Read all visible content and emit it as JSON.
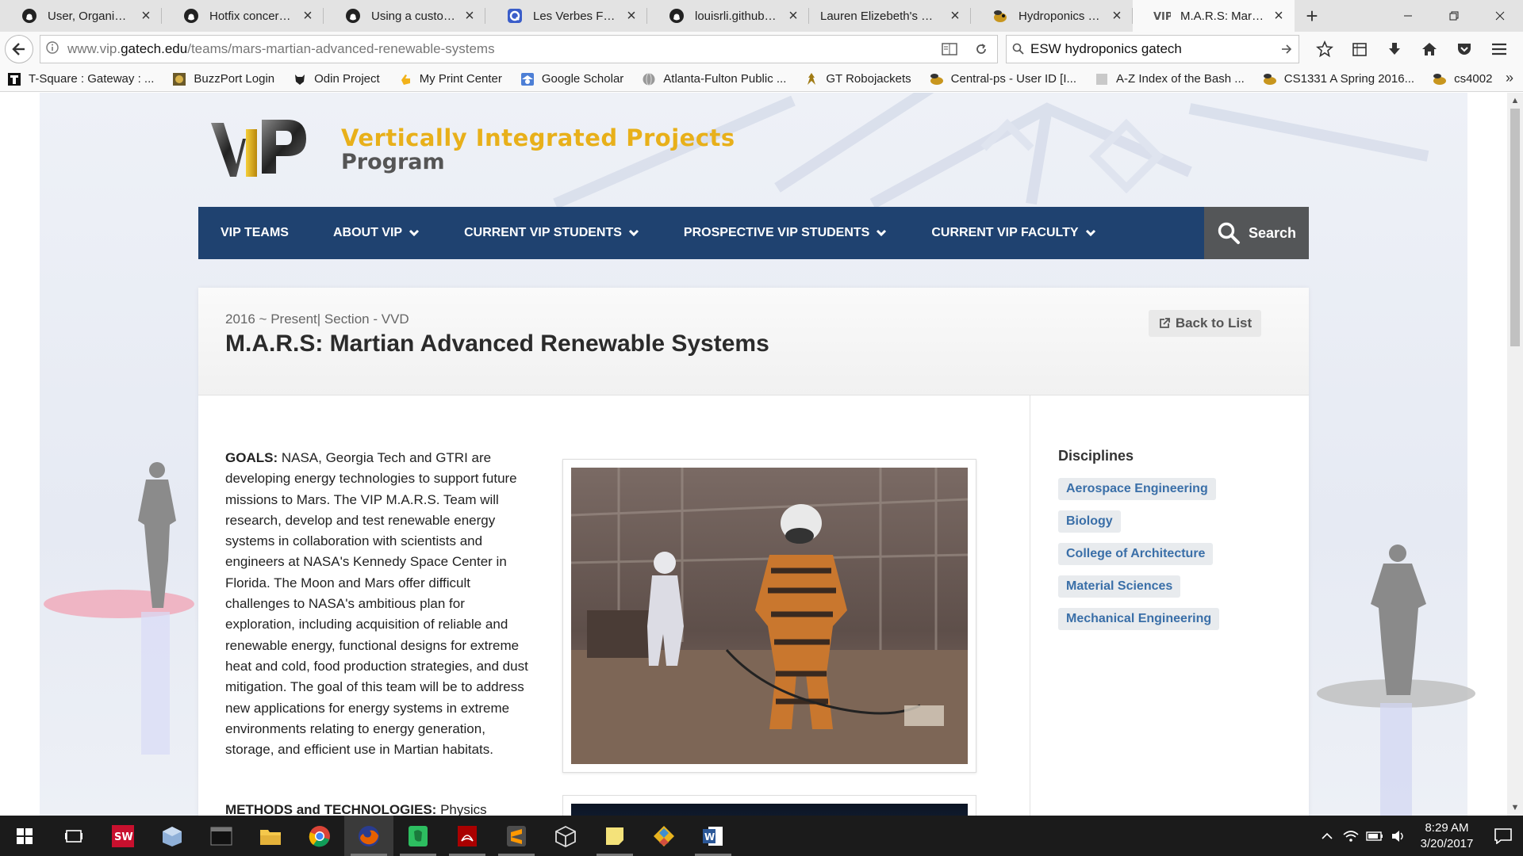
{
  "browser": {
    "tabs": [
      {
        "title": "User, Organizatio...",
        "icon": "github-icon"
      },
      {
        "title": "Hotfix concernin...",
        "icon": "github-icon"
      },
      {
        "title": "Using a custom d...",
        "icon": "github-icon"
      },
      {
        "title": "Les Verbes Flashc...",
        "icon": "quizlet-icon"
      },
      {
        "title": "louisrli.github.co...",
        "icon": "github-icon"
      },
      {
        "title": "Lauren Elizebeth's Per...",
        "icon": "none"
      },
      {
        "title": "Hydroponics proj...",
        "icon": "buzz-icon"
      },
      {
        "title": "M.A.R.S: Martian ...",
        "icon": "vip-icon",
        "active": true
      }
    ],
    "url_prefix": "www.vip.",
    "url_domain": "gatech.edu",
    "url_path": "/teams/mars-martian-advanced-renewable-systems",
    "search_query": "ESW hydroponics gatech",
    "bookmarks": [
      {
        "label": "T-Square : Gateway : ...",
        "icon": "tsquare-icon"
      },
      {
        "label": "BuzzPort Login",
        "icon": "buzzport-icon"
      },
      {
        "label": "Odin Project",
        "icon": "odin-icon"
      },
      {
        "label": "My Print Center",
        "icon": "hand-icon"
      },
      {
        "label": "Google Scholar",
        "icon": "scholar-icon"
      },
      {
        "label": "Atlanta-Fulton Public ...",
        "icon": "globe-icon"
      },
      {
        "label": "GT Robojackets",
        "icon": "robo-icon"
      },
      {
        "label": "Central-ps - User ID [I...",
        "icon": "buzz-icon"
      },
      {
        "label": "A-Z Index of the Bash ...",
        "icon": "square-icon"
      },
      {
        "label": "CS1331 A Spring 2016...",
        "icon": "buzz-icon"
      },
      {
        "label": "cs4002",
        "icon": "buzz-icon"
      }
    ]
  },
  "site": {
    "title": "Vertically Integrated Projects",
    "subtitle": "Program",
    "logo_text": "VIP",
    "nav": [
      {
        "label": "VIP TEAMS",
        "dropdown": false
      },
      {
        "label": "ABOUT VIP",
        "dropdown": true
      },
      {
        "label": "CURRENT VIP STUDENTS",
        "dropdown": true
      },
      {
        "label": "PROSPECTIVE VIP STUDENTS",
        "dropdown": true
      },
      {
        "label": "CURRENT VIP FACULTY",
        "dropdown": true
      }
    ],
    "search_label": "Search"
  },
  "team": {
    "meta": "2016 ~ Present| Section - VVD",
    "title": "M.A.R.S: Martian Advanced Renewable Systems",
    "back_label": "Back to List",
    "goals_label": "GOALS:",
    "goals_text": "NASA, Georgia Tech and GTRI are developing energy technologies to support future missions to Mars. The VIP M.A.R.S. Team will research, develop and test renewable energy systems in collaboration with scientists and engineers at NASA's Kennedy Space Center in Florida. The Moon and Mars offer difficult challenges to NASA's ambitious plan for exploration, including acquisition of reliable and renewable energy, functional designs for extreme heat and cold, food production strategies, and dust mitigation. The goal of this team will be to address new applications for energy systems in extreme environments relating to energy generation, storage, and efficient use in Martian habitats.",
    "methods_label": "METHODS and TECHNOLOGIES:",
    "methods_text": "Physics",
    "disciplines_title": "Disciplines",
    "disciplines": [
      "Aerospace Engineering",
      "Biology",
      "College of Architecture",
      "Material Sciences",
      "Mechanical Engineering"
    ]
  },
  "taskbar": {
    "apps": [
      "solidworks-icon",
      "virtualbox-icon",
      "terminal-icon",
      "file-explorer-icon",
      "chrome-icon",
      "firefox-icon",
      "evernote-icon",
      "acrobat-icon",
      "sublime-icon",
      "cube-icon",
      "sticky-notes-icon",
      "git-icon",
      "word-icon"
    ],
    "time": "8:29 AM",
    "date": "3/20/2017"
  },
  "colors": {
    "nav_blue": "#1f4270",
    "vip_gold": "#e8b01a",
    "discipline_text": "#3a6fa8"
  }
}
